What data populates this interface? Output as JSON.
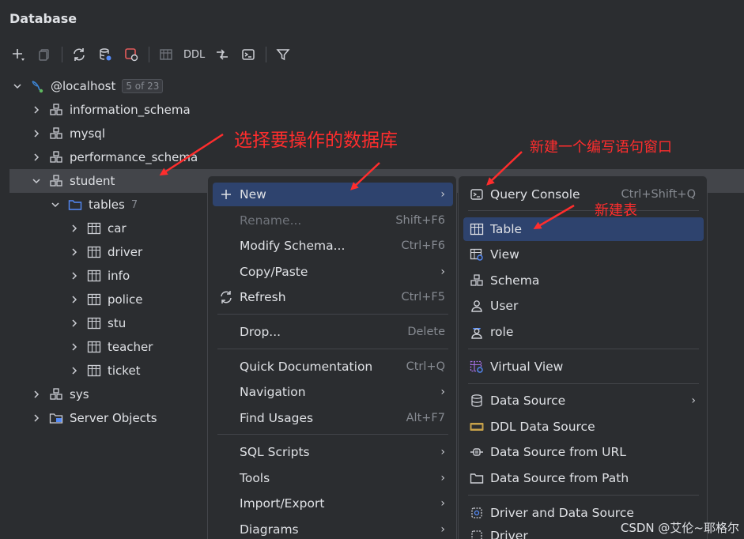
{
  "panel_title": "Database",
  "toolbar": {
    "ddl_label": "DDL"
  },
  "tree": {
    "host": {
      "label": "@localhost",
      "badge": "5 of 23"
    },
    "schemas": [
      "information_schema",
      "mysql",
      "performance_schema"
    ],
    "selected_schema": "student",
    "tables_folder": {
      "label": "tables",
      "count": "7"
    },
    "tables": [
      "car",
      "driver",
      "info",
      "police",
      "stu",
      "teacher",
      "ticket"
    ],
    "after": [
      "sys",
      "Server Objects"
    ]
  },
  "context_menu": {
    "items": [
      {
        "label": "New",
        "shortcut": "",
        "submenu": true,
        "highlighted": true
      },
      {
        "label": "Rename...",
        "shortcut": "Shift+F6",
        "disabled": true
      },
      {
        "label": "Modify Schema...",
        "shortcut": "Ctrl+F6"
      },
      {
        "label": "Copy/Paste",
        "shortcut": "",
        "submenu": true
      },
      {
        "label": "Refresh",
        "shortcut": "Ctrl+F5"
      },
      {
        "label": "Drop...",
        "shortcut": "Delete"
      },
      {
        "label": "Quick Documentation",
        "shortcut": "Ctrl+Q"
      },
      {
        "label": "Navigation",
        "shortcut": "",
        "submenu": true
      },
      {
        "label": "Find Usages",
        "shortcut": "Alt+F7"
      },
      {
        "label": "SQL Scripts",
        "shortcut": "",
        "submenu": true
      },
      {
        "label": "Tools",
        "shortcut": "",
        "submenu": true
      },
      {
        "label": "Import/Export",
        "shortcut": "",
        "submenu": true
      },
      {
        "label": "Diagrams",
        "shortcut": "",
        "submenu": true
      }
    ]
  },
  "submenu_new": {
    "items": [
      {
        "label": "Query Console",
        "shortcut": "Ctrl+Shift+Q"
      },
      {
        "label": "Table",
        "highlighted": true
      },
      {
        "label": "View"
      },
      {
        "label": "Schema"
      },
      {
        "label": "User"
      },
      {
        "label": "role"
      },
      {
        "label": "Virtual View"
      },
      {
        "label": "Data Source",
        "submenu": true
      },
      {
        "label": "DDL Data Source"
      },
      {
        "label": "Data Source from URL"
      },
      {
        "label": "Data Source from Path"
      },
      {
        "label": "Driver and Data Source"
      },
      {
        "label": "Driver"
      }
    ]
  },
  "annotations": {
    "select_db": "选择要操作的数据库",
    "new_console": "新建一个编写语句窗口",
    "new_table": "新建表"
  },
  "watermark": "CSDN @艾伦~耶格尔",
  "colors": {
    "highlight": "#2e436e",
    "annotation": "#ff2d2d",
    "folder": "#548af7"
  }
}
